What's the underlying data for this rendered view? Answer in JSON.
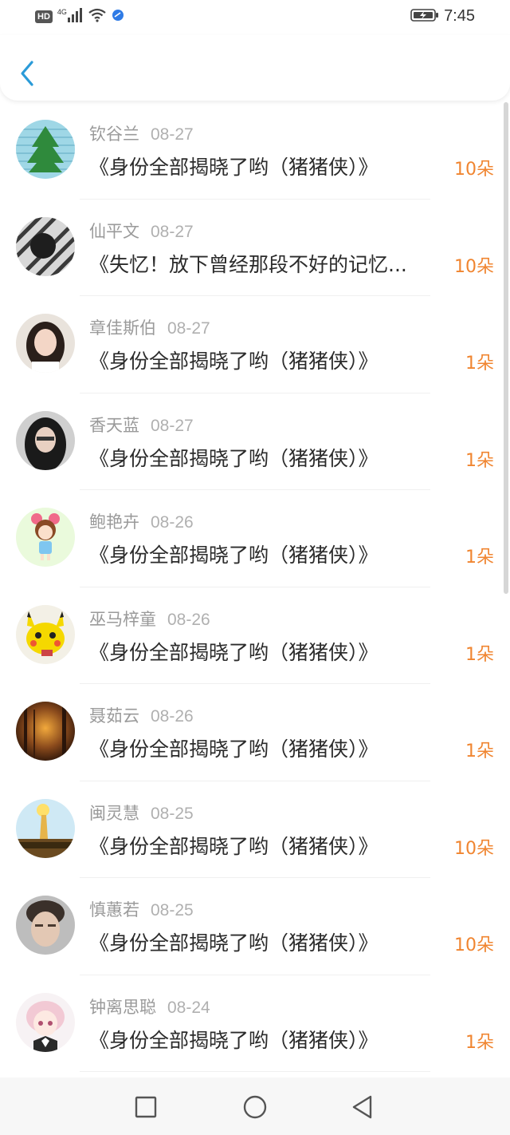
{
  "status_bar": {
    "hd": "HD",
    "network": "4G",
    "time": "7:45",
    "icons": [
      "signal-icon",
      "wifi-icon",
      "app-notify-icon",
      "battery-charging-icon"
    ]
  },
  "header": {
    "back_icon": "chevron-left-icon"
  },
  "items": [
    {
      "name": "钦谷兰",
      "date": "08-27",
      "title": "《身份全部揭晓了哟（猪猪侠）》",
      "count": "10朵",
      "avatar": "tree"
    },
    {
      "name": "仙平文",
      "date": "08-27",
      "title": "《失忆！放下曾经那段不好的记忆...",
      "count": "10朵",
      "avatar": "boy-stripes"
    },
    {
      "name": "章佳斯伯",
      "date": "08-27",
      "title": "《身份全部揭晓了哟（猪猪侠）》",
      "count": "1朵",
      "avatar": "girl-light"
    },
    {
      "name": "香天蓝",
      "date": "08-27",
      "title": "《身份全部揭晓了哟（猪猪侠）》",
      "count": "1朵",
      "avatar": "girl-dark"
    },
    {
      "name": "鲍艳卉",
      "date": "08-26",
      "title": "《身份全部揭晓了哟（猪猪侠）》",
      "count": "1朵",
      "avatar": "cartoon-girl"
    },
    {
      "name": "巫马梓童",
      "date": "08-26",
      "title": "《身份全部揭晓了哟（猪猪侠）》",
      "count": "1朵",
      "avatar": "pikachu"
    },
    {
      "name": "聂茹云",
      "date": "08-26",
      "title": "《身份全部揭晓了哟（猪猪侠）》",
      "count": "1朵",
      "avatar": "forest"
    },
    {
      "name": "闽灵慧",
      "date": "08-25",
      "title": "《身份全部揭晓了哟（猪猪侠）》",
      "count": "10朵",
      "avatar": "sky"
    },
    {
      "name": "慎蕙若",
      "date": "08-25",
      "title": "《身份全部揭晓了哟（猪猪侠）》",
      "count": "10朵",
      "avatar": "boy-face"
    },
    {
      "name": "钟离思聪",
      "date": "08-24",
      "title": "《身份全部揭晓了哟（猪猪侠）》",
      "count": "1朵",
      "avatar": "anime-girl"
    }
  ],
  "nav_bar": {
    "icons": [
      "recent-apps-square-icon",
      "home-circle-icon",
      "back-triangle-icon"
    ]
  },
  "colors": {
    "accent": "#2b9bd8",
    "count": "#f08530",
    "meta": "#9a9a9a",
    "title": "#2b2b2b"
  }
}
